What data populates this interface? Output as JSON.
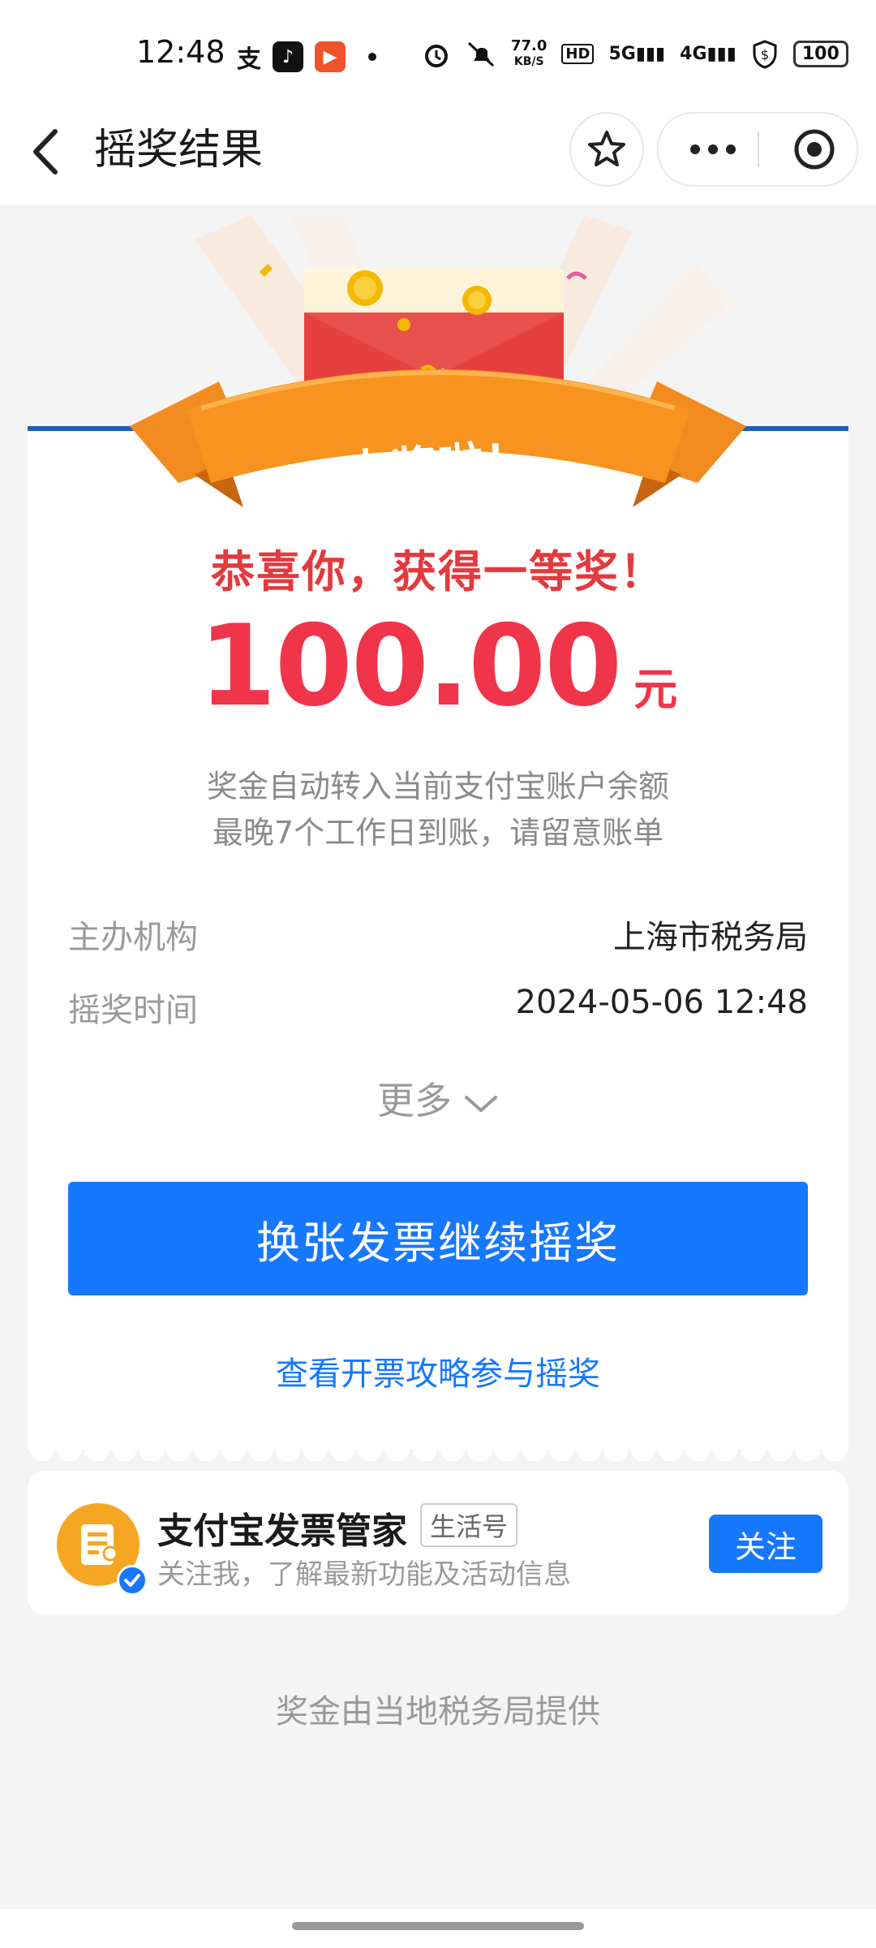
{
  "status_bar": {
    "time": "12:48",
    "net_speed_value": "77.0",
    "net_speed_unit": "KB/S",
    "hd": "HD",
    "signal_5g": "5G",
    "signal_4g": "4G",
    "battery": "100"
  },
  "nav": {
    "title": "摇奖结果",
    "back_icon": "chevron-left-icon",
    "star_icon": "star-icon",
    "more_icon": "more-dots-icon",
    "close_icon": "target-circle-icon"
  },
  "result": {
    "banner": "中奖啦！",
    "congrats": "恭喜你，获得一等奖！",
    "amount": "100.00",
    "unit": "元",
    "note_line1": "奖金自动转入当前支付宝账户余额",
    "note_line2": "最晚7个工作日到账，请留意账单"
  },
  "details": [
    {
      "label": "主办机构",
      "value": "上海市税务局"
    },
    {
      "label": "摇奖时间",
      "value": "2024-05-06 12:48"
    }
  ],
  "more_label": "更多",
  "primary_button": "换张发票继续摇奖",
  "guide_link": "查看开票攻略参与摇奖",
  "follow_card": {
    "title": "支付宝发票管家",
    "tag": "生活号",
    "subtitle": "关注我，了解最新功能及活动信息",
    "button": "关注"
  },
  "footer_note": "奖金由当地税务局提供",
  "colors": {
    "accent_blue": "#1677ff",
    "prize_red": "#f0344a",
    "ribbon_orange": "#f7931e"
  }
}
